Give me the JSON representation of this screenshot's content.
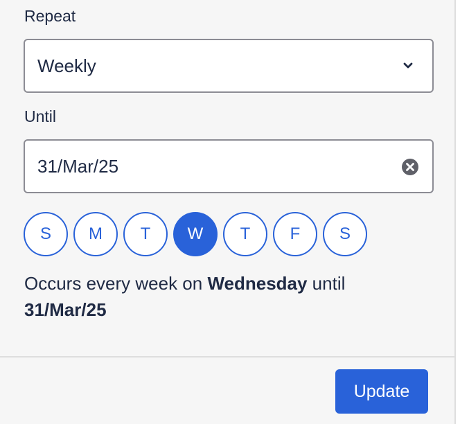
{
  "repeat": {
    "label": "Repeat",
    "value": "Weekly"
  },
  "until": {
    "label": "Until",
    "value": "31/Mar/25"
  },
  "days": [
    {
      "letter": "S",
      "selected": false
    },
    {
      "letter": "M",
      "selected": false
    },
    {
      "letter": "T",
      "selected": false
    },
    {
      "letter": "W",
      "selected": true
    },
    {
      "letter": "T",
      "selected": false
    },
    {
      "letter": "F",
      "selected": false
    },
    {
      "letter": "S",
      "selected": false
    }
  ],
  "summary": {
    "prefix": "Occurs every week on ",
    "day": "Wednesday",
    "middle": " until",
    "date": "31/Mar/25"
  },
  "footer": {
    "update_label": "Update"
  },
  "colors": {
    "accent": "#2962d9",
    "text": "#1f2a44",
    "panel_bg": "#f6f6f6",
    "border": "#8c8c94"
  },
  "icons": {
    "repeat_dropdown": "chevron-down-icon",
    "until_clear": "clear-icon"
  }
}
